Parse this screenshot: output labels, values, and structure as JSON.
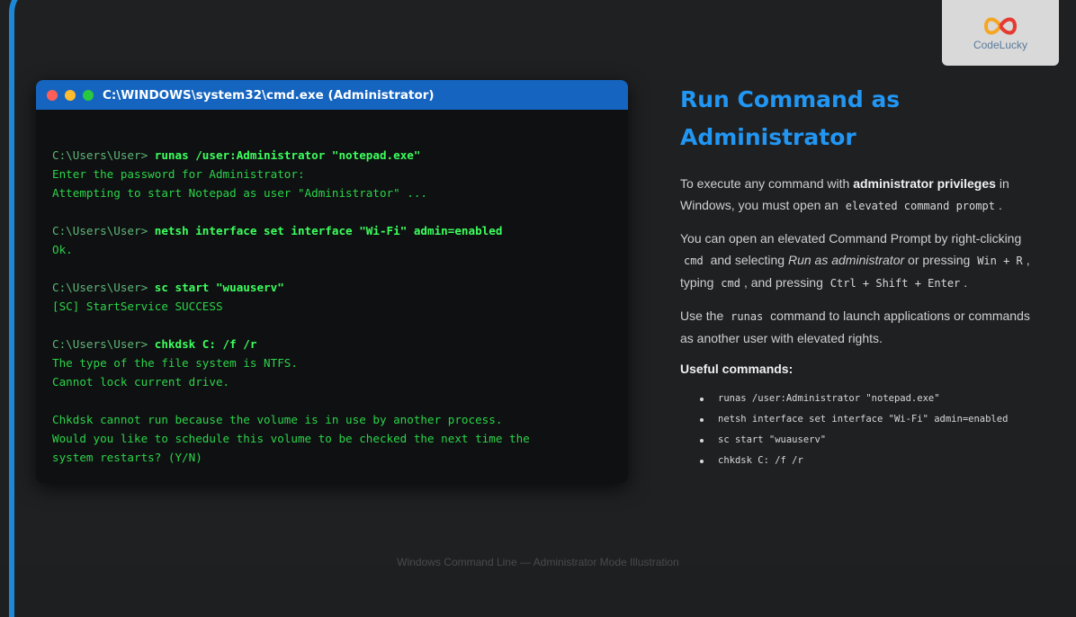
{
  "logo": {
    "name": "CodeLucky",
    "icon": "infinity-logo-icon"
  },
  "terminal": {
    "title": "C:\\WINDOWS\\system32\\cmd.exe (Administrator)",
    "blocks": [
      {
        "prompt": "C:\\Users\\User> ",
        "command": "runas /user:Administrator \"notepad.exe\"",
        "output": [
          "Enter the password for Administrator:",
          "Attempting to start Notepad as user \"Administrator\" ..."
        ]
      },
      {
        "prompt": "C:\\Users\\User> ",
        "command": "netsh interface set interface \"Wi-Fi\" admin=enabled",
        "output": [
          "Ok."
        ]
      },
      {
        "prompt": "C:\\Users\\User> ",
        "command": "sc start \"wuauserv\"",
        "output": [
          "[SC] StartService SUCCESS"
        ]
      },
      {
        "prompt": "C:\\Users\\User> ",
        "command": "chkdsk C: /f /r",
        "output": [
          "The type of the file system is NTFS.",
          "Cannot lock current drive.",
          "",
          "Chkdsk cannot run because the volume is in use by another process.",
          "Would you like to schedule this volume to be checked the next time the",
          "system restarts? (Y/N)"
        ]
      }
    ]
  },
  "panel": {
    "title_line1": "Run Command as",
    "title_line2": "Administrator",
    "p1": {
      "a": "To execute any command with ",
      "b": "administrator privileges",
      "c": " in Windows, you must open an ",
      "code": "elevated command prompt",
      "d": "."
    },
    "p2": {
      "a": "You can open an elevated Command Prompt by right-clicking ",
      "code1": "cmd",
      "b": " and selecting ",
      "italic": "Run as administrator",
      "c": " or pressing ",
      "code2": "Win + R",
      "d": ", typing ",
      "code3": "cmd",
      "e": ", and pressing ",
      "code4": "Ctrl + Shift + Enter",
      "f": "."
    },
    "p3": {
      "a": "Use the ",
      "code": "runas",
      "b": " command to launch applications or commands as another user with elevated rights."
    },
    "useful_heading": "Useful commands:",
    "commands": [
      "runas /user:Administrator \"notepad.exe\"",
      "netsh interface set interface \"Wi-Fi\" admin=enabled",
      "sc start \"wuauserv\"",
      "chkdsk C: /f /r"
    ]
  },
  "caption": "Windows Command Line — Administrator Mode Illustration",
  "colors": {
    "accent": "#1e88d6",
    "title_blue": "#2196f3",
    "terminal_green": "#2bd44a",
    "titlebar": "#1565c0"
  }
}
